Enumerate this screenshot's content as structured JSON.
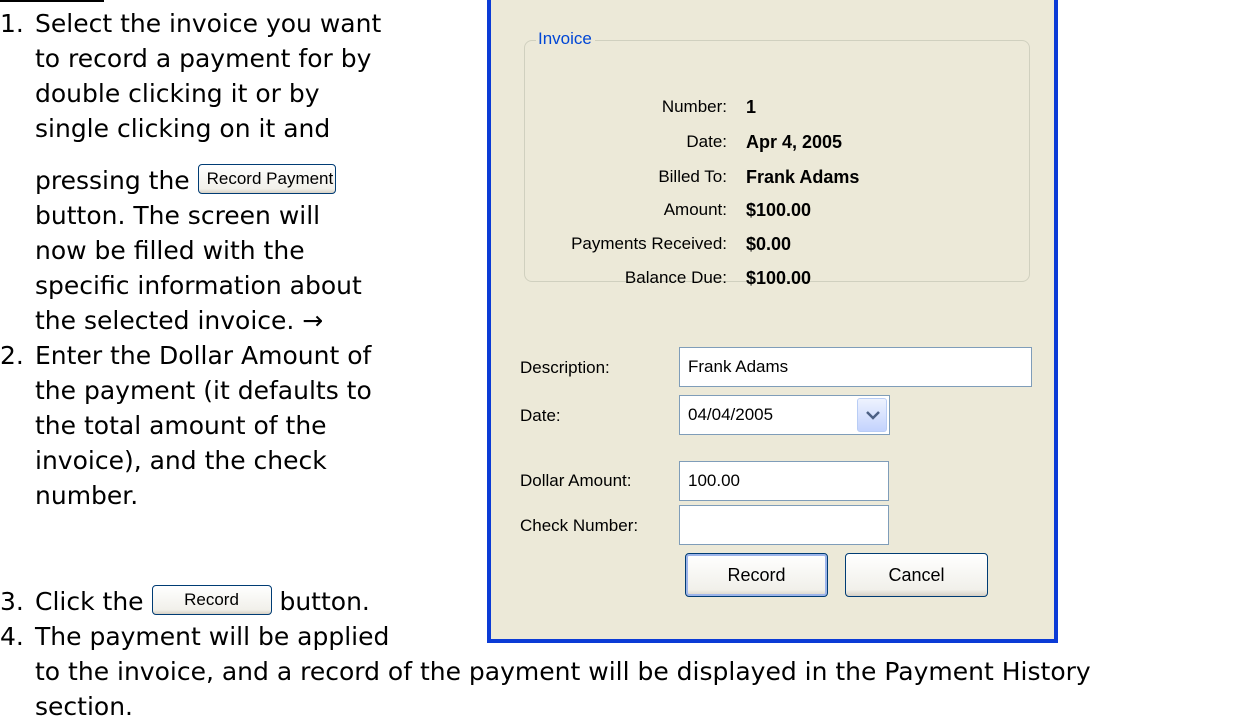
{
  "instructions": {
    "step1": {
      "number": "1.",
      "lines": [
        "Select the invoice you want",
        "to record a payment for by",
        "double clicking it or by",
        "single clicking on it and"
      ],
      "pressing": "pressing the",
      "button_label": "Record Payment",
      "after_lines": [
        "button.  The screen will",
        "now be filled with the",
        "specific information about",
        "the selected invoice. →"
      ]
    },
    "step2": {
      "number": "2.",
      "lines": [
        "Enter the Dollar Amount of",
        "the payment (it defaults to",
        "the total amount of the",
        "invoice), and the check",
        "number."
      ]
    },
    "step3": {
      "number": "3.",
      "prefix": "Click the",
      "button_label": "Record",
      "suffix": "button."
    },
    "step4": {
      "number": "4.",
      "lines": [
        "The payment will be applied",
        "to the invoice, and a record of the payment will be displayed in the Payment History",
        "section."
      ]
    }
  },
  "dialog": {
    "group_title": "Invoice",
    "invoice": [
      {
        "label": "Number:",
        "value": "1"
      },
      {
        "label": "Date:",
        "value": "Apr 4, 2005"
      },
      {
        "label": "Billed To:",
        "value": "Frank Adams"
      },
      {
        "label": "Amount:",
        "value": "$100.00"
      },
      {
        "label": "Payments Received:",
        "value": "$0.00"
      },
      {
        "label": "Balance Due:",
        "value": "$100.00"
      }
    ],
    "description_label": "Description:",
    "description_value": "Frank Adams",
    "date_label": "Date:",
    "date_value": "04/04/2005",
    "dollar_label": "Dollar Amount:",
    "dollar_value": "100.00",
    "check_label": "Check Number:",
    "check_value": "",
    "record_button": "Record",
    "cancel_button": "Cancel",
    "colors": {
      "frame": "#0b3bd6",
      "background": "#ece9d8",
      "group_title": "#0046d5"
    },
    "icons": {
      "dropdown": "chevron-down-icon"
    }
  }
}
